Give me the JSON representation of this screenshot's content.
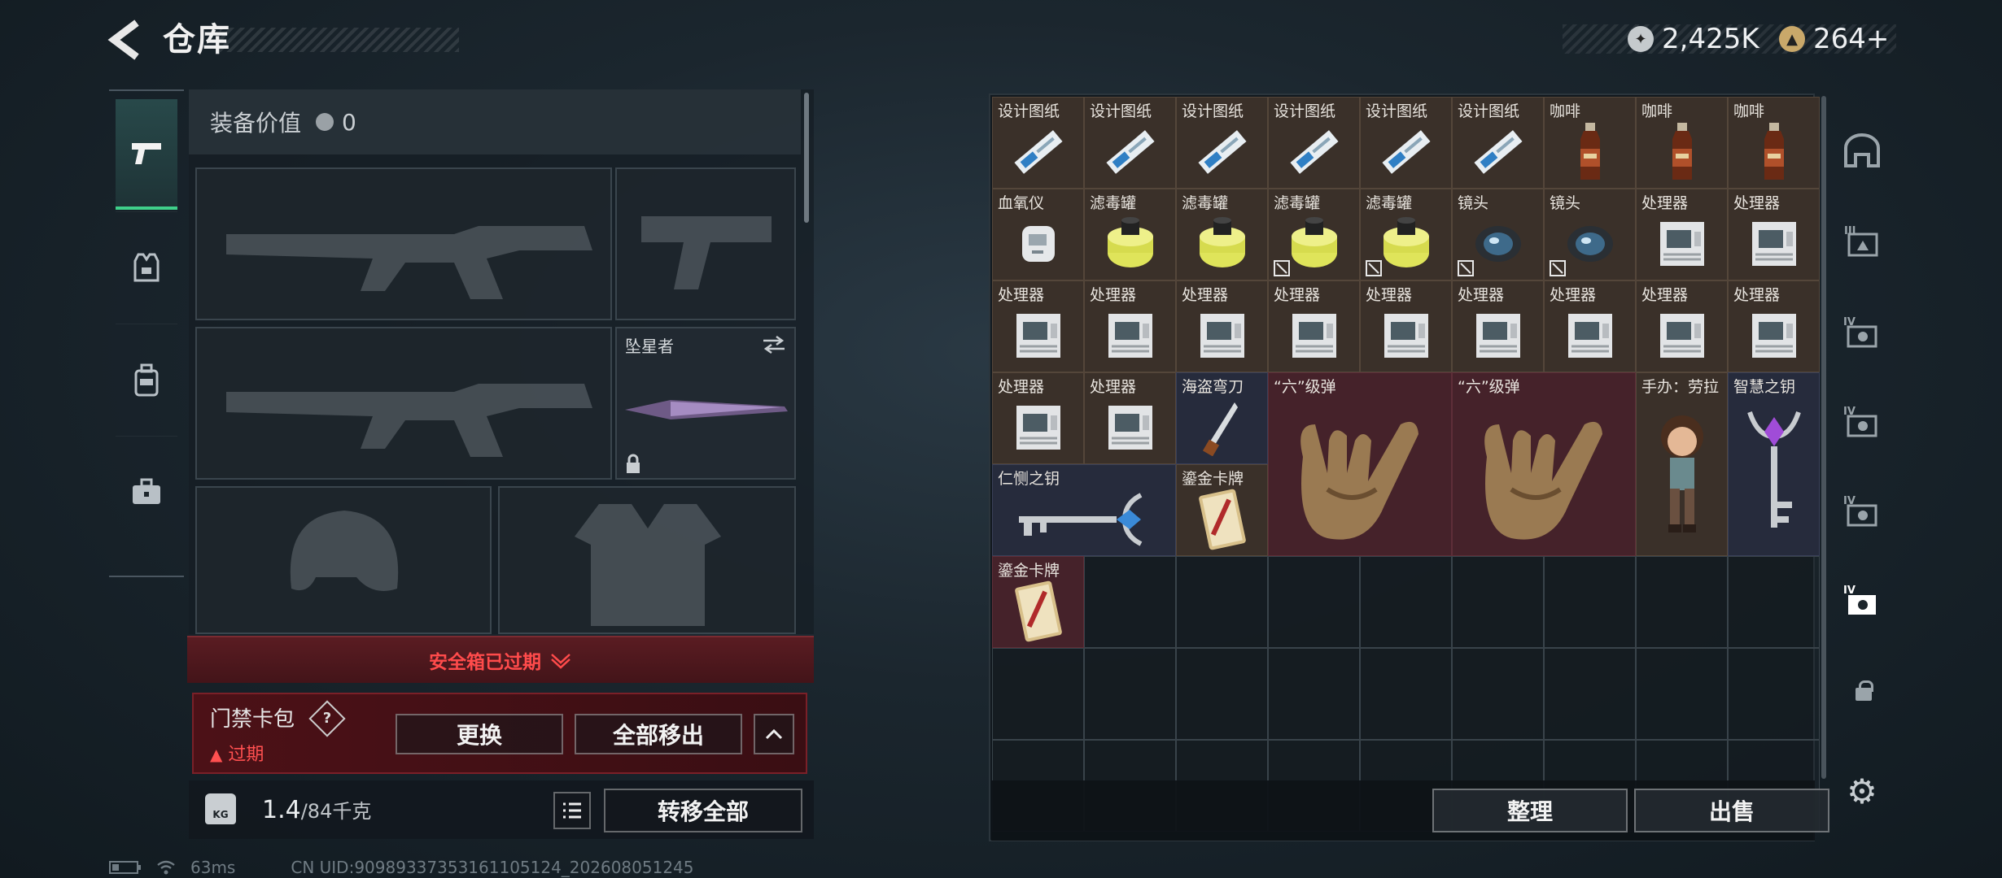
{
  "header": {
    "title": "仓库",
    "currencies": [
      {
        "icon": "silver-coin-icon",
        "value": "2,425K"
      },
      {
        "icon": "gold-coin-icon",
        "value": "264+"
      }
    ]
  },
  "equipment": {
    "value_label": "装备价值",
    "value": "0",
    "melee_name": "坠星者"
  },
  "safe_box": {
    "banner": "安全箱已过期",
    "card_pack": "门禁卡包",
    "help": "?",
    "status": "过期",
    "replace": "更换",
    "move_all_out": "全部移出"
  },
  "weight": {
    "current": "1.4",
    "max": "/84千克",
    "kg_badge": "KG",
    "transfer_all": "转移全部"
  },
  "footer": {
    "ping": "63ms",
    "uid": "CN UID:909893373531611051​24_202608051245"
  },
  "storage": {
    "items": [
      {
        "name": "设计图纸",
        "icon": "blueprint-icon"
      },
      {
        "name": "设计图纸",
        "icon": "blueprint-icon"
      },
      {
        "name": "设计图纸",
        "icon": "blueprint-icon"
      },
      {
        "name": "设计图纸",
        "icon": "blueprint-icon"
      },
      {
        "name": "设计图纸",
        "icon": "blueprint-icon"
      },
      {
        "name": "设计图纸",
        "icon": "blueprint-icon"
      },
      {
        "name": "咖啡",
        "icon": "coffee-bottle-icon"
      },
      {
        "name": "咖啡",
        "icon": "coffee-bottle-icon"
      },
      {
        "name": "咖啡",
        "icon": "coffee-bottle-icon"
      },
      {
        "name": "血氧仪",
        "icon": "oximeter-icon"
      },
      {
        "name": "滤毒罐",
        "icon": "filter-canister-icon"
      },
      {
        "name": "滤毒罐",
        "icon": "filter-canister-icon"
      },
      {
        "name": "滤毒罐",
        "icon": "filter-canister-icon"
      },
      {
        "name": "滤毒罐",
        "icon": "filter-canister-icon"
      },
      {
        "name": "镜头",
        "icon": "lens-icon"
      },
      {
        "name": "镜头",
        "icon": "lens-icon"
      },
      {
        "name": "处理器",
        "icon": "processor-icon"
      },
      {
        "name": "处理器",
        "icon": "processor-icon"
      },
      {
        "name": "处理器",
        "icon": "processor-icon"
      },
      {
        "name": "处理器",
        "icon": "processor-icon"
      },
      {
        "name": "处理器",
        "icon": "processor-icon"
      },
      {
        "name": "处理器",
        "icon": "processor-icon"
      },
      {
        "name": "处理器",
        "icon": "processor-icon"
      },
      {
        "name": "处理器",
        "icon": "processor-icon"
      },
      {
        "name": "处理器",
        "icon": "processor-icon"
      },
      {
        "name": "处理器",
        "icon": "processor-icon"
      },
      {
        "name": "处理器",
        "icon": "processor-icon"
      },
      {
        "name": "处理器",
        "icon": "processor-icon"
      },
      {
        "name": "处理器",
        "icon": "processor-icon"
      },
      {
        "name": "海盗弯刀",
        "icon": "pirate-knife-icon"
      },
      {
        "name": "“六”级弹",
        "icon": "six-hand-sign-icon"
      },
      {
        "name": "“六”级弹",
        "icon": "six-hand-sign-icon"
      },
      {
        "name": "手办：劳拉",
        "icon": "lara-figure-icon"
      },
      {
        "name": "智慧之钥",
        "icon": "wisdom-key-icon"
      },
      {
        "name": "仁恻之钥",
        "icon": "mercy-key-icon"
      },
      {
        "name": "鎏金卡牌",
        "icon": "gilded-card-icon"
      },
      {
        "name": "鎏金卡牌",
        "icon": "gilded-card-icon"
      }
    ],
    "sort_button": "整理",
    "sell_button": "出售"
  },
  "colors": {
    "accent_green": "#3fd08a",
    "expired_red": "#ff4b4b",
    "cell_brown": "#3a3029",
    "cell_red": "#45222a",
    "cell_blue": "#262b3c"
  }
}
